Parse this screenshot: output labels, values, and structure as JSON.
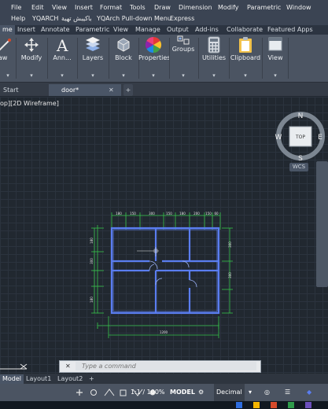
{
  "menu": {
    "row1": [
      "File",
      "Edit",
      "View",
      "Insert",
      "Format",
      "Tools",
      "Draw",
      "Dimension",
      "Modify",
      "Parametric",
      "Window"
    ],
    "row2": [
      "Help",
      "YQARCH",
      "ﺑﺎﻛﻴﺒﺶ ﺗﻬﻴﺔ",
      "YQArch Pull-down Menu",
      "Express"
    ]
  },
  "ribbon_tabs": [
    "me",
    "Insert",
    "Annotate",
    "Parametric",
    "View",
    "Manage",
    "Output",
    "Add-ins",
    "Collaborate",
    "Featured Apps"
  ],
  "ribbon_panels": [
    {
      "label": "aw",
      "icon": "draw-icon"
    },
    {
      "label": "Modify",
      "icon": "move-icon"
    },
    {
      "label": "Ann...",
      "icon": "text-icon"
    },
    {
      "label": "Layers",
      "icon": "layers-icon"
    },
    {
      "label": "Block",
      "icon": "block-icon"
    },
    {
      "label": "Properties",
      "icon": "color-wheel-icon"
    },
    {
      "label": "Groups",
      "icon": "groups-icon"
    },
    {
      "label": "Utilities",
      "icon": "calculator-icon"
    },
    {
      "label": "Clipboard",
      "icon": "clipboard-icon"
    },
    {
      "label": "View",
      "icon": "view-icon"
    }
  ],
  "doc_tabs": {
    "start": "Start",
    "active": "door*",
    "new": "+"
  },
  "viewport": {
    "label": "op][2D Wireframe]"
  },
  "viewcube": {
    "n": "N",
    "s": "S",
    "e": "E",
    "w": "W",
    "top": "TOP",
    "wcs": "WCS"
  },
  "dimensions": {
    "top": [
      "180",
      "150",
      "300",
      "150",
      "180",
      "200",
      "150",
      "60"
    ],
    "bottom": "1200",
    "left_a": "180",
    "left_b": "300",
    "left_c": "180",
    "right_a": "300",
    "right_b": "300"
  },
  "command_line": {
    "placeholder": "Type a command",
    "close": "✕",
    "settings": "🔧"
  },
  "layout_tabs": [
    "Model",
    "Layout1",
    "Layout2",
    "+"
  ],
  "status": {
    "model": "MODEL",
    "scale": "1:1 / 100%",
    "units": "Decimal"
  },
  "colors": {
    "wall": "#5a7df0",
    "dim": "#36c24a",
    "accent": "#d64a2a"
  }
}
